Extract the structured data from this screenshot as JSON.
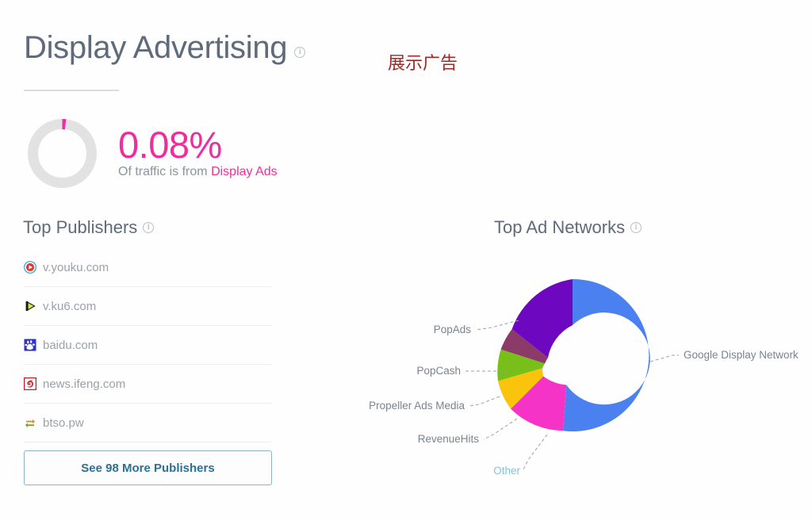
{
  "header": {
    "title": "Display Advertising",
    "info_icon": "info-icon",
    "translation_tag": "展示广告"
  },
  "traffic_share": {
    "percent_label": "0.08%",
    "percent_value": 0.08,
    "caption_prefix": "Of traffic is from ",
    "caption_accent": "Display Ads",
    "accent_color": "#ee2d9e",
    "track_color": "#e2e2e2"
  },
  "publishers": {
    "heading": "Top Publishers",
    "info_icon": "info-icon",
    "items": [
      {
        "name": "v.youku.com",
        "icon": "youku-favicon"
      },
      {
        "name": "v.ku6.com",
        "icon": "ku6-favicon"
      },
      {
        "name": "baidu.com",
        "icon": "baidu-favicon"
      },
      {
        "name": "news.ifeng.com",
        "icon": "ifeng-favicon"
      },
      {
        "name": "btso.pw",
        "icon": "btso-favicon"
      }
    ],
    "more_button_label": "See 98 More Publishers",
    "more_count": 98
  },
  "networks": {
    "heading": "Top Ad Networks",
    "info_icon": "info-icon"
  },
  "chart_data": {
    "type": "pie",
    "title": "Top Ad Networks",
    "subtype": "donut",
    "legend_position": "callout-labels",
    "categories": [
      "Google Display Network",
      "Other",
      "RevenueHits",
      "Propeller Ads Media",
      "PopCash",
      "PopAds"
    ],
    "values": [
      52,
      13,
      7,
      7,
      6,
      15
    ],
    "colors": [
      "#4a80ef",
      "#f533c6",
      "#f9c40b",
      "#78c019",
      "#8c3a67",
      "#6d07c0"
    ],
    "labels": {
      "google_display_network": "Google Display Network",
      "other": "Other",
      "revenuehits": "RevenueHits",
      "propeller_ads_media": "Propeller Ads Media",
      "popcash": "PopCash",
      "popads": "PopAds"
    },
    "other_label_color": "#7fc2e8"
  }
}
